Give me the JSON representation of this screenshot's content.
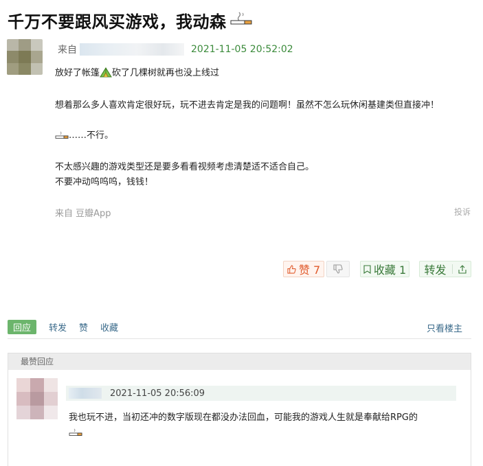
{
  "post": {
    "title": "千万不要跟风买游戏，我动森",
    "title_emoji": "cigarette-icon",
    "meta_from": "来自",
    "timestamp": "2021-11-05 20:52:02",
    "content": {
      "line1_a": "放好了帐篷",
      "line1_b": "砍了几棵树就再也没上线过",
      "line2": "想着那么多人喜欢肯定很好玩，玩不进去肯定是我的问题啊！虽然不怎么玩休闲基建类但直接冲！",
      "line3": "……不行。",
      "line4": "不太感兴趣的游戏类型还是要多看看视频考虑清楚适不适合自己。",
      "line5": "不要冲动呜呜呜，钱钱！"
    },
    "source_app": "来自 豆瓣App",
    "report_label": "投诉"
  },
  "actions": {
    "like_label": "赞 7",
    "collect_label": "收藏 1",
    "share_label": "转发"
  },
  "tabs": {
    "items": [
      "回应",
      "转发",
      "赞",
      "收藏"
    ],
    "only_op": "只看楼主"
  },
  "best_reply": {
    "header": "最赞回应",
    "timestamp": "2021-11-05 20:56:09",
    "text": "我也玩不进，当初还冲的数字版现在都没办法回血，可能我的游戏人生就是奉献给RPG的"
  },
  "colors": {
    "accent_green": "#6cb56c",
    "timestamp_green": "#3a8a3a",
    "like_orange": "#e05a2b"
  }
}
